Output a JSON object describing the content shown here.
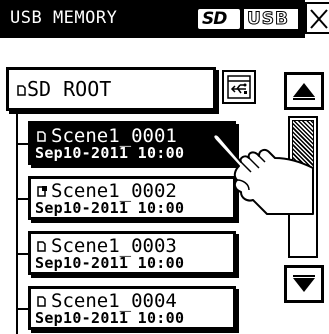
{
  "titlebar": {
    "title": "USB MEMORY",
    "sd_badge": "SD",
    "usb_badge": "USB",
    "close_icon": "close-icon"
  },
  "root_folder": {
    "label": "SD ROOT",
    "folder_icon": "folder-icon",
    "transfer_icon": "usb-transfer-icon"
  },
  "scenes": [
    {
      "name": "Scene1_0001",
      "date": "Sep10-2011 10:00",
      "selected": true,
      "protected": false
    },
    {
      "name": "Scene1_0002",
      "date": "Sep10-2011 10:00",
      "selected": false,
      "protected": true
    },
    {
      "name": "Scene1_0003",
      "date": "Sep10-2011 10:00",
      "selected": false,
      "protected": false
    },
    {
      "name": "Scene1_0004",
      "date": "Sep10-2011 10:00",
      "selected": false,
      "protected": false
    }
  ],
  "scrollbar": {
    "up_icon": "arrow-up-icon",
    "down_icon": "arrow-down-icon",
    "thumb_position_fraction": 0.0,
    "thumb_size_fraction": 0.55
  },
  "pointer": {
    "icon": "hand-pointer-icon"
  }
}
